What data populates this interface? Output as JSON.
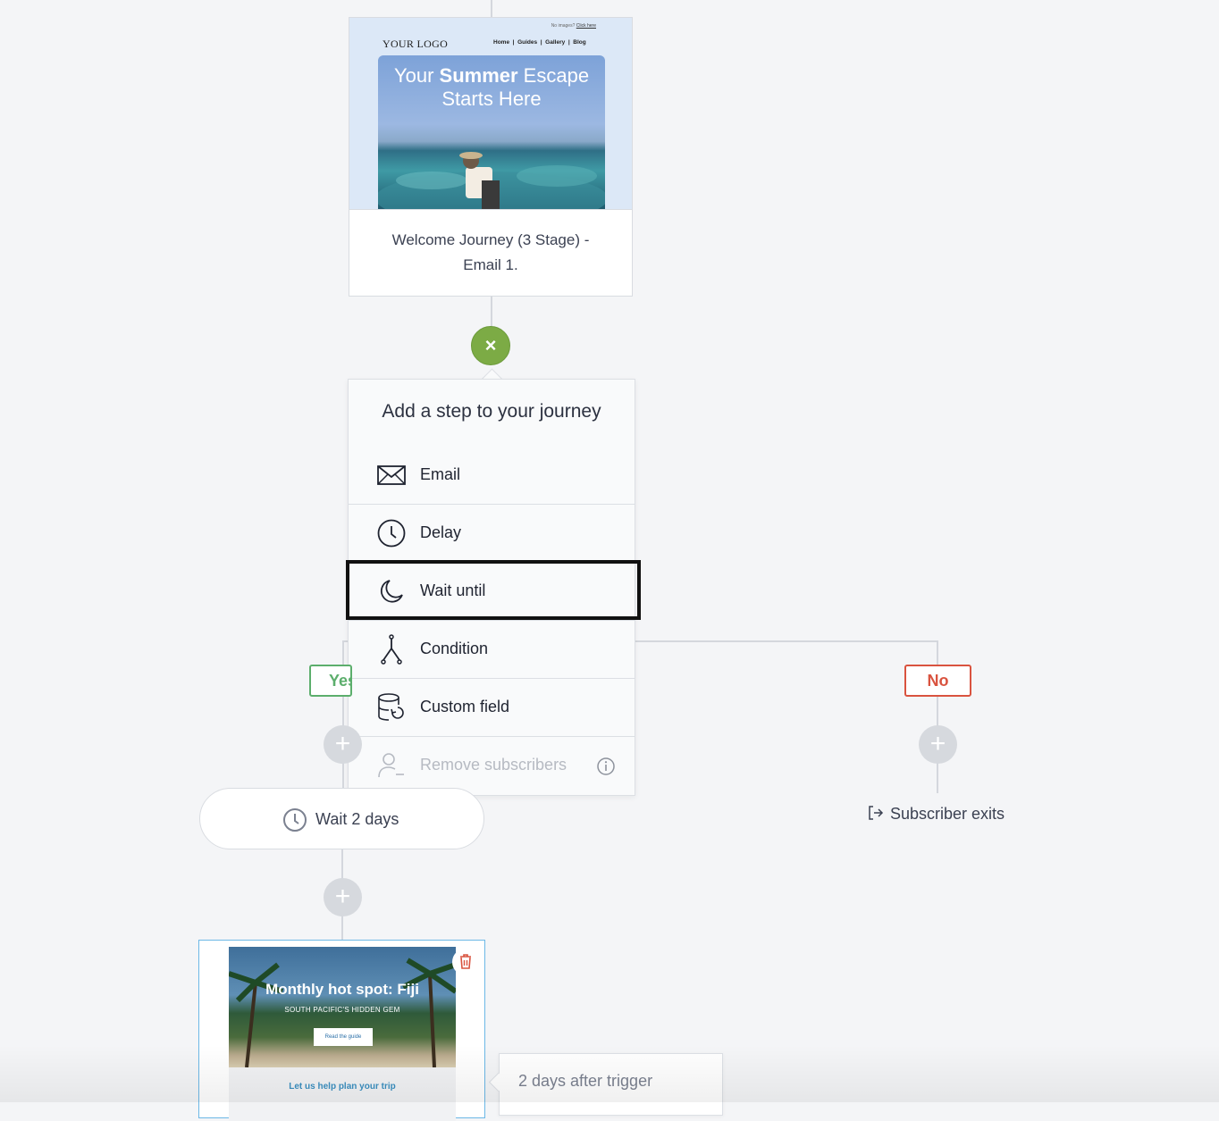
{
  "email_card": {
    "no_images_text": "No images?",
    "click_here": "Click here",
    "logo": "YOUR LOGO",
    "nav": "Home  |  Guides  |  Gallery  |  Blog",
    "hero_pre": "Your ",
    "hero_bold": "Summer",
    "hero_post": " Escape",
    "hero_line2": "Starts Here",
    "caption_line1": "Welcome Journey (3 Stage) -",
    "caption_line2": "Email 1."
  },
  "close_button": "×",
  "menu": {
    "title": "Add a step to your journey",
    "items": [
      {
        "label": "Email",
        "icon": "envelope-icon"
      },
      {
        "label": "Delay",
        "icon": "clock-icon"
      },
      {
        "label": "Wait until",
        "icon": "moon-icon"
      },
      {
        "label": "Condition",
        "icon": "branch-icon"
      },
      {
        "label": "Custom field",
        "icon": "database-icon"
      },
      {
        "label": "Remove subscribers",
        "icon": "remove-user-icon"
      }
    ]
  },
  "branches": {
    "yes_label": "Yes",
    "no_label": "No",
    "plus": "+",
    "exit_label": "Subscriber exits"
  },
  "wait_step": {
    "label": "Wait 2 days"
  },
  "email2": {
    "title": "Monthly hot spot: Fiji",
    "subtitle": "SOUTH PACIFIC'S HIDDEN GEM",
    "button": "Read the guide",
    "body_text": "Let us help plan your trip"
  },
  "tooltip": {
    "text": "2 days after trigger"
  },
  "colors": {
    "background": "#f4f5f7",
    "accent_green": "#7cab45",
    "yes_green": "#5cae6c",
    "no_red": "#d9533f",
    "selected_border": "#6cb8e6"
  }
}
